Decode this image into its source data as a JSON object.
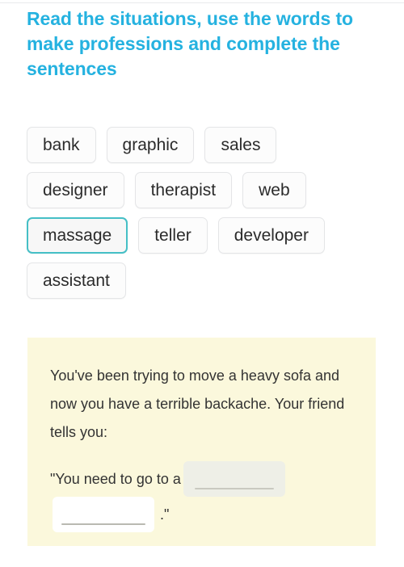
{
  "task": {
    "title": "Read the situations, use the words to make professions and complete the sentences"
  },
  "word_bank": {
    "words": [
      {
        "label": "bank",
        "selected": false
      },
      {
        "label": "graphic",
        "selected": false
      },
      {
        "label": "sales",
        "selected": false
      },
      {
        "label": "designer",
        "selected": false
      },
      {
        "label": "therapist",
        "selected": false
      },
      {
        "label": "web",
        "selected": false
      },
      {
        "label": "massage",
        "selected": true
      },
      {
        "label": "teller",
        "selected": false
      },
      {
        "label": "developer",
        "selected": false
      },
      {
        "label": "assistant",
        "selected": false
      }
    ]
  },
  "exercise": {
    "scenario": "You've been trying to move a heavy sofa and now you have a terrible backache. Your friend tells you:",
    "answer_prefix": "\"You need to go to a",
    "blank_1_value": "",
    "blank_2_value": "",
    "answer_suffix": ".\""
  },
  "colors": {
    "title": "#25b2e0",
    "chip_border": "#e4e5e7",
    "chip_selected_border": "#45bfc6",
    "card_background": "#fbf8dc",
    "body_text": "#333333"
  }
}
